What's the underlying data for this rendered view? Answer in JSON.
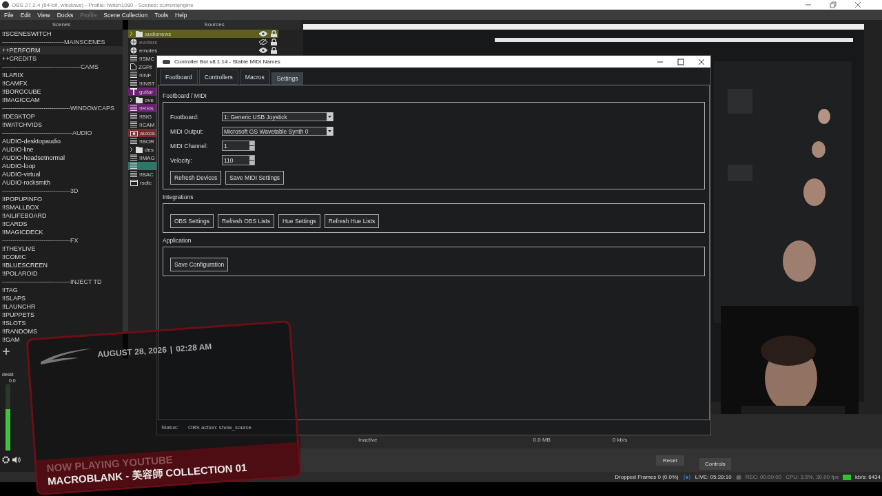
{
  "obs": {
    "title": "OBS 27.2.4 (64-bit, windows) - Profile: twitch1080 - Scenes: currentengine",
    "menu": [
      {
        "label": "File",
        "disabled": false
      },
      {
        "label": "Edit",
        "disabled": false
      },
      {
        "label": "View",
        "disabled": false
      },
      {
        "label": "Docks",
        "disabled": false
      },
      {
        "label": "Profile",
        "disabled": true
      },
      {
        "label": "Scene Collection",
        "disabled": false
      },
      {
        "label": "Tools",
        "disabled": false
      },
      {
        "label": "Help",
        "disabled": false
      }
    ],
    "scenes": {
      "header": "Scenes",
      "items": [
        {
          "kind": "scene",
          "label": "!!SCENESWITCH",
          "selected": false
        },
        {
          "kind": "separator",
          "label": "------------------------------MAINSCENES",
          "selected": false
        },
        {
          "kind": "scene",
          "label": "++PERFORM",
          "selected": true
        },
        {
          "kind": "scene",
          "label": "++CREDITS",
          "selected": false
        },
        {
          "kind": "separator",
          "label": "--------------------------------------CAMS",
          "selected": false
        },
        {
          "kind": "scene",
          "label": "!!LARIX",
          "selected": false
        },
        {
          "kind": "scene",
          "label": "!!CAMFX",
          "selected": false
        },
        {
          "kind": "scene",
          "label": "!!BORGCUBE",
          "selected": false
        },
        {
          "kind": "scene",
          "label": "!!MAGICCAM",
          "selected": false
        },
        {
          "kind": "separator",
          "label": "---------------------------------WINDOWCAPS",
          "selected": false
        },
        {
          "kind": "scene",
          "label": "!!DESKTOP",
          "selected": false
        },
        {
          "kind": "scene",
          "label": "!!WATCHVIDS",
          "selected": false
        },
        {
          "kind": "separator",
          "label": "----------------------------------AUDIO",
          "selected": false
        },
        {
          "kind": "scene",
          "label": "AUDIO-desktopaudio",
          "selected": false
        },
        {
          "kind": "scene",
          "label": "AUDIO-line",
          "selected": false
        },
        {
          "kind": "scene",
          "label": "AUDIO-headsetnormal",
          "selected": false
        },
        {
          "kind": "scene",
          "label": "AUDIO-loop",
          "selected": false
        },
        {
          "kind": "scene",
          "label": "AUDIO-virtual",
          "selected": false
        },
        {
          "kind": "scene",
          "label": "AUDIO-rocksmith",
          "selected": false
        },
        {
          "kind": "separator",
          "label": "---------------------------------3D",
          "selected": false
        },
        {
          "kind": "scene",
          "label": "!!POPUPINFO",
          "selected": false
        },
        {
          "kind": "scene",
          "label": "!!SMALLBOX",
          "selected": false
        },
        {
          "kind": "scene",
          "label": "!!AILIFEBOARD",
          "selected": false
        },
        {
          "kind": "scene",
          "label": "!!CARDS",
          "selected": false
        },
        {
          "kind": "scene",
          "label": "!!MAGICDECK",
          "selected": false
        },
        {
          "kind": "separator",
          "label": "---------------------------------FX",
          "selected": false
        },
        {
          "kind": "scene",
          "label": "!!THEYLIVE",
          "selected": false
        },
        {
          "kind": "scene",
          "label": "!!COMIC",
          "selected": false
        },
        {
          "kind": "scene",
          "label": "!!BLUESCREEN",
          "selected": false
        },
        {
          "kind": "scene",
          "label": "!!POLAROID",
          "selected": false
        },
        {
          "kind": "separator",
          "label": "---------------------------------INJECT TD",
          "selected": false
        },
        {
          "kind": "scene",
          "label": "!!TAG",
          "selected": false
        },
        {
          "kind": "scene",
          "label": "!!SLAPS",
          "selected": false
        },
        {
          "kind": "scene",
          "label": "!!LAUNCHR",
          "selected": false
        },
        {
          "kind": "scene",
          "label": "!!PUPPETS",
          "selected": false
        },
        {
          "kind": "scene",
          "label": "!!SLOTS",
          "selected": false
        },
        {
          "kind": "scene",
          "label": "!!RANDOMS",
          "selected": false
        },
        {
          "kind": "scene",
          "label": "!!GAM",
          "selected": false
        }
      ]
    },
    "sources": {
      "header": "Sources",
      "items": [
        {
          "kind": "folder",
          "label": "audionews",
          "color": "#5e5f1c",
          "visible": true,
          "locked": true
        },
        {
          "kind": "browser",
          "label": "evotars",
          "visible": false,
          "locked": true
        },
        {
          "kind": "browser",
          "label": "emotes",
          "visible": true,
          "locked": true
        },
        {
          "kind": "list",
          "label": "!!SMC"
        },
        {
          "kind": "file",
          "label": "ZGRt"
        },
        {
          "kind": "list",
          "label": "!!INF"
        },
        {
          "kind": "list",
          "label": "!!INST"
        },
        {
          "kind": "text",
          "label": "guitar",
          "color": "#6a1f70"
        },
        {
          "kind": "folder",
          "label": "ove"
        },
        {
          "kind": "list",
          "label": "!!RSS",
          "color": "#6a1f70"
        },
        {
          "kind": "list",
          "label": "!!BIG"
        },
        {
          "kind": "list",
          "label": "!!CAM"
        },
        {
          "kind": "camera",
          "label": "auxca",
          "color": "#7a2a2e"
        },
        {
          "kind": "list",
          "label": "!!BOR"
        },
        {
          "kind": "folder",
          "label": "des"
        },
        {
          "kind": "list",
          "label": "!!MAG"
        },
        {
          "kind": "list",
          "color": "#2a7868"
        },
        {
          "kind": "list",
          "label": "!!BAC"
        },
        {
          "kind": "window",
          "label": "rsdic"
        }
      ]
    },
    "preview": {
      "kind": "picture"
    },
    "mixer": {
      "channels": [
        {
          "name": "deskt",
          "reading": "0.0",
          "level": 0.62
        }
      ]
    },
    "stats": [
      "Inactive",
      "0.0 MB",
      "0 kb/s"
    ],
    "reset_button": "Reset",
    "dock_tab": "Controls",
    "status_bar": {
      "dropped": "Dropped Frames 0 (0.0%)",
      "live": "LIVE: 05:28:10",
      "rec": "REC: 00:00:00",
      "cpu": "CPU: 3.5%, 30.00 fps",
      "kbps": "kb/s: 6434"
    }
  },
  "controller_bot": {
    "title": "Controller Bot v8.1.14 - Stable MIDI Names",
    "tabs": [
      {
        "label": "Footboard",
        "selected": false
      },
      {
        "label": "Controllers",
        "selected": false
      },
      {
        "label": "Macros",
        "selected": false
      },
      {
        "label": "Settings",
        "selected": true
      }
    ],
    "sections": [
      {
        "title": "Footboard / MIDI",
        "fields": [
          {
            "kind": "dropdown",
            "label": "Footboard:",
            "value": "1: Generic USB Joystick"
          },
          {
            "kind": "dropdown",
            "label": "MIDI Output:",
            "value": "Microsoft GS Wavetable Synth 0"
          },
          {
            "kind": "spinner",
            "label": "MIDI Channel:",
            "value": "1"
          },
          {
            "kind": "spinner",
            "label": "Velocity:",
            "value": "110"
          }
        ],
        "buttons": [
          "Refresh Devices",
          "Save MIDI Settings"
        ]
      },
      {
        "title": "Integrations",
        "buttons": [
          "OBS Settings",
          "Refresh OBS Lists",
          "Hue Settings",
          "Refresh Hue Lists"
        ]
      },
      {
        "title": "Application",
        "buttons": [
          "Save Configuration"
        ]
      }
    ],
    "status": {
      "label": "Status:",
      "value": "OBS action: show_source"
    }
  },
  "overlay": {
    "date": "AUGUST 28, 2026",
    "divider": "|",
    "time": "02:28 AM",
    "now_playing": "NOW PLAYING YOUTUBE",
    "track": "MACROBLANK - 美容師 COLLECTION 01"
  }
}
